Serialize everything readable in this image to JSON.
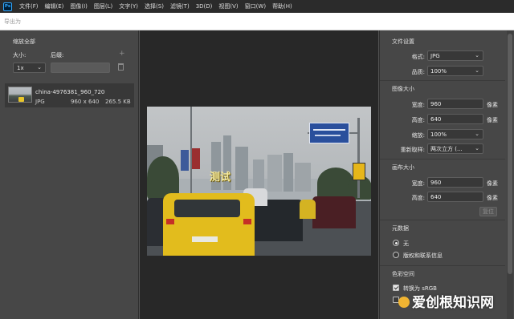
{
  "menubar": {
    "logo_text": "Ps",
    "items": [
      {
        "label": "文件(F)",
        "name": "menu-file"
      },
      {
        "label": "编辑(E)",
        "name": "menu-edit"
      },
      {
        "label": "图像(I)",
        "name": "menu-image"
      },
      {
        "label": "图层(L)",
        "name": "menu-layer"
      },
      {
        "label": "文字(Y)",
        "name": "menu-type"
      },
      {
        "label": "选择(S)",
        "name": "menu-select"
      },
      {
        "label": "滤镜(T)",
        "name": "menu-filter"
      },
      {
        "label": "3D(D)",
        "name": "menu-3d"
      },
      {
        "label": "视图(V)",
        "name": "menu-view"
      },
      {
        "label": "窗口(W)",
        "name": "menu-window"
      },
      {
        "label": "帮助(H)",
        "name": "menu-help"
      }
    ]
  },
  "dialog": {
    "title": "导出为"
  },
  "left_panel": {
    "heading": "缩放全部",
    "size_label": "大小:",
    "suffix_label": "后缀:",
    "scale_value": "1x",
    "suffix_value": "",
    "file": {
      "name": "china-4976381_960_720",
      "format": "JPG",
      "dimensions": "960 x 640",
      "size": "265.5 KB"
    }
  },
  "preview": {
    "watermark_text": "测试"
  },
  "file_settings": {
    "heading": "文件设置",
    "format_label": "格式:",
    "format_value": "JPG",
    "quality_label": "品质:",
    "quality_value": "100%"
  },
  "image_size": {
    "heading": "图像大小",
    "width_label": "宽度:",
    "width_value": "960",
    "height_label": "高度:",
    "height_value": "640",
    "unit": "像素",
    "scale_label": "缩放:",
    "scale_value": "100%",
    "resample_label": "重新取样:",
    "resample_value": "两次立方 (..."
  },
  "canvas_size": {
    "heading": "画布大小",
    "width_label": "宽度:",
    "width_value": "960",
    "height_label": "高度:",
    "height_value": "640",
    "unit": "像素",
    "reset_label": "复位"
  },
  "metadata": {
    "heading": "元数据",
    "option_none": "无",
    "option_copyright": "版权和联系信息"
  },
  "color_space": {
    "heading": "色彩空间",
    "convert_label": "转换为 sRGB"
  },
  "overlay": {
    "site_watermark": "爱创根知识网"
  },
  "colors": {
    "panel_bg": "#474747",
    "preview_bg": "#282828",
    "menubar_bg": "#2b2b2b",
    "ps_accent": "#31a8ff",
    "taxi_yellow": "#e2bc1d"
  }
}
